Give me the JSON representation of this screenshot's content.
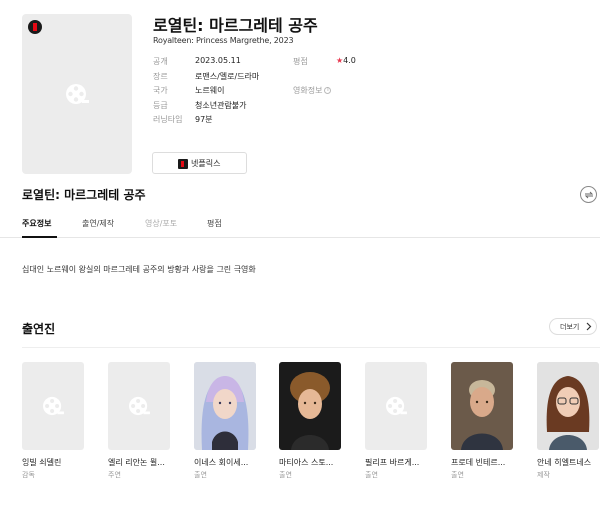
{
  "movie": {
    "title": "로열틴: 마르그레테 공주",
    "subtitle": "Royalteen: Princess Margrethe, 2023",
    "info": [
      {
        "label": "공개",
        "value": "2023.05.11"
      },
      {
        "label": "장르",
        "value": "로맨스/멜로/드라마"
      },
      {
        "label": "국가",
        "value": "노르웨이"
      },
      {
        "label": "등급",
        "value": "청소년관람불가"
      },
      {
        "label": "러닝타임",
        "value": "97분"
      }
    ],
    "rating_label": "평점",
    "rating_star": "★",
    "rating_value": "4.0",
    "movie_info_label": "영화정보",
    "info_icon_glyph": "i",
    "ott_label": "넷플릭스"
  },
  "section": {
    "title": "로열틴: 마르그레테 공주"
  },
  "tabs": [
    {
      "label": "주요정보"
    },
    {
      "label": "출연/제작"
    },
    {
      "label": "영상/포토"
    },
    {
      "label": "평점"
    }
  ],
  "synopsis": "십대인 노르웨이 왕실의 마르그레테 공주의 방황과 사랑을 그린 극영화",
  "cast": {
    "title": "출연진",
    "more_label": "더보기",
    "members": [
      {
        "name": "잉빌 쇠델린",
        "role": "감독",
        "photo": "placeholder"
      },
      {
        "name": "엘리 리안논 뮐...",
        "role": "주연",
        "photo": "placeholder"
      },
      {
        "name": "이네스 회이세...",
        "role": "출연",
        "photo": "woman-blue-hair"
      },
      {
        "name": "마티아스 스토...",
        "role": "출연",
        "photo": "young-man-curly"
      },
      {
        "name": "필리프 바르게...",
        "role": "출연",
        "photo": "placeholder"
      },
      {
        "name": "프로데 빈테르...",
        "role": "출연",
        "photo": "older-man"
      },
      {
        "name": "안네 히엘트네스",
        "role": "제작",
        "photo": "woman-glasses"
      }
    ]
  },
  "colors": {
    "accent_red": "#e50914",
    "star": "#e8384f"
  }
}
